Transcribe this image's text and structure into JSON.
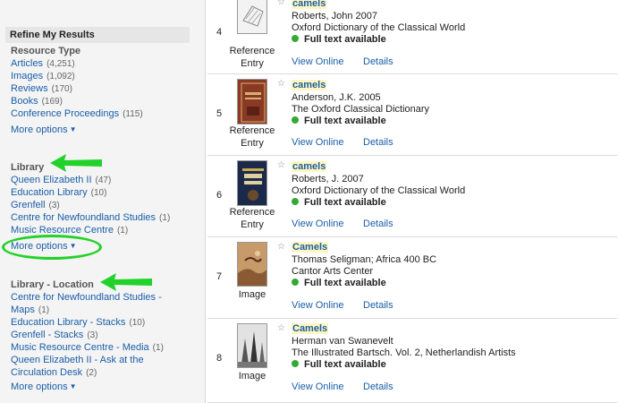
{
  "sidebar": {
    "refine_title": "Refine My Results",
    "resource_type": {
      "title": "Resource Type",
      "items": [
        {
          "label": "Articles",
          "count": "(4,251)"
        },
        {
          "label": "Images",
          "count": "(1,092)"
        },
        {
          "label": "Reviews",
          "count": "(170)"
        },
        {
          "label": "Books",
          "count": "(169)"
        },
        {
          "label": "Conference Proceedings",
          "count": "(115)"
        }
      ],
      "more": "More options"
    },
    "library": {
      "title": "Library",
      "items": [
        {
          "label": "Queen Elizabeth II",
          "count": "(47)"
        },
        {
          "label": "Education Library",
          "count": "(10)"
        },
        {
          "label": "Grenfell",
          "count": "(3)"
        },
        {
          "label": "Centre for Newfoundland Studies",
          "count": "(1)"
        },
        {
          "label": "Music Resource Centre",
          "count": "(1)"
        }
      ],
      "more": "More options"
    },
    "library_location": {
      "title": "Library - Location",
      "items": [
        {
          "label1": "Centre for Newfoundland Studies -",
          "label2": "Maps",
          "count": "(1)"
        },
        {
          "label1": "Education Library - Stacks",
          "count": "(10)"
        },
        {
          "label1": "Grenfell - Stacks",
          "count": "(3)"
        },
        {
          "label1": "Music Resource Centre - Media",
          "count": "(1)"
        },
        {
          "label1": "Queen Elizabeth II - Ask at the",
          "label2": "Circulation Desk",
          "count": "(2)"
        }
      ],
      "more": "More options"
    }
  },
  "results": [
    {
      "num": "4",
      "title": "camels",
      "author": "Roberts, John 2007",
      "source": "Oxford Dictionary of the Classical World",
      "fulltext": "Full text available",
      "type1": "Reference",
      "type2": "Entry",
      "view": "View Online",
      "details": "Details"
    },
    {
      "num": "5",
      "title": "camels",
      "author": "Anderson, J.K. 2005",
      "source": "The Oxford Classical Dictionary",
      "fulltext": "Full text available",
      "type1": "Reference",
      "type2": "Entry",
      "view": "View Online",
      "details": "Details"
    },
    {
      "num": "6",
      "title": "camels",
      "author": "Roberts, J. 2007",
      "source": "Oxford Dictionary of the Classical World",
      "fulltext": "Full text available",
      "type1": "Reference",
      "type2": "Entry",
      "view": "View Online",
      "details": "Details"
    },
    {
      "num": "7",
      "title": "Camels",
      "author": "Thomas Seligman; Africa 400 BC",
      "source": "Cantor Arts Center",
      "fulltext": "Full text available",
      "type1": "Image",
      "type2": "",
      "view": "View Online",
      "details": "Details"
    },
    {
      "num": "8",
      "title": "Camels",
      "author": "Herman van Swanevelt",
      "source": "The Illustrated Bartsch. Vol. 2, Netherlandish Artists",
      "fulltext": "Full text available",
      "type1": "Image",
      "type2": "",
      "view": "View Online",
      "details": "Details"
    }
  ],
  "colors": {
    "link": "#1a5ea8",
    "annotation": "#22d22a",
    "available": "#33aa33",
    "highlight": "#fff6c0"
  },
  "icons": [
    "star-icon",
    "chevron-down-icon",
    "green-dot-icon",
    "annotation-arrow-icon"
  ]
}
